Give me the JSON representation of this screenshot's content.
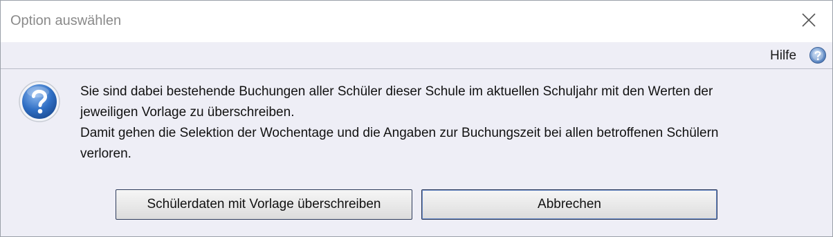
{
  "window": {
    "title": "Option auswählen",
    "close_icon": "close-icon"
  },
  "help": {
    "label": "Hilfe",
    "icon": "help-icon"
  },
  "message": {
    "icon": "question-icon",
    "lines": [
      "Sie sind dabei bestehende Buchungen aller Schüler dieser Schule im aktuellen Schuljahr mit den Werten der",
      "jeweiligen Vorlage zu überschreiben.",
      "Damit gehen die Selektion der Wochentage und die Angaben zur Buchungszeit bei allen betroffenen Schülern",
      "verloren."
    ]
  },
  "buttons": {
    "overwrite_label": "Schülerdaten mit Vorlage überschreiben",
    "cancel_label": "Abbrechen"
  },
  "colors": {
    "background": "#eeeef6",
    "titlebar": "#ffffff",
    "icon_blue": "#2f6fc4"
  }
}
